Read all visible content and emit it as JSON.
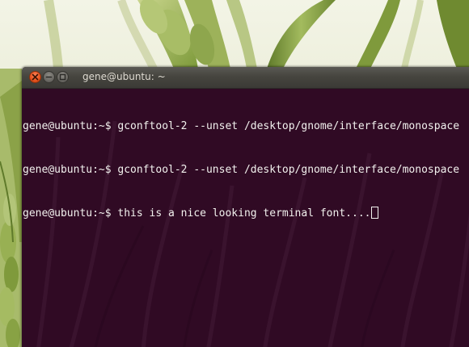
{
  "window": {
    "title": "gene@ubuntu: ~"
  },
  "terminal": {
    "prompt": "gene@ubuntu:~$ ",
    "lines": [
      "gconftool-2 --unset /desktop/gnome/interface/monospace",
      "gconftool-2 --unset /desktop/gnome/interface/monospace",
      "this is a nice looking terminal font...."
    ]
  },
  "colors": {
    "terminal_background": "#300a24",
    "terminal_text": "#f2f1ee",
    "close_button": "#e9541f",
    "titlebar": "#46453f"
  },
  "icons": {
    "close": "close-icon",
    "minimize": "minimize-icon",
    "maximize": "maximize-icon"
  }
}
